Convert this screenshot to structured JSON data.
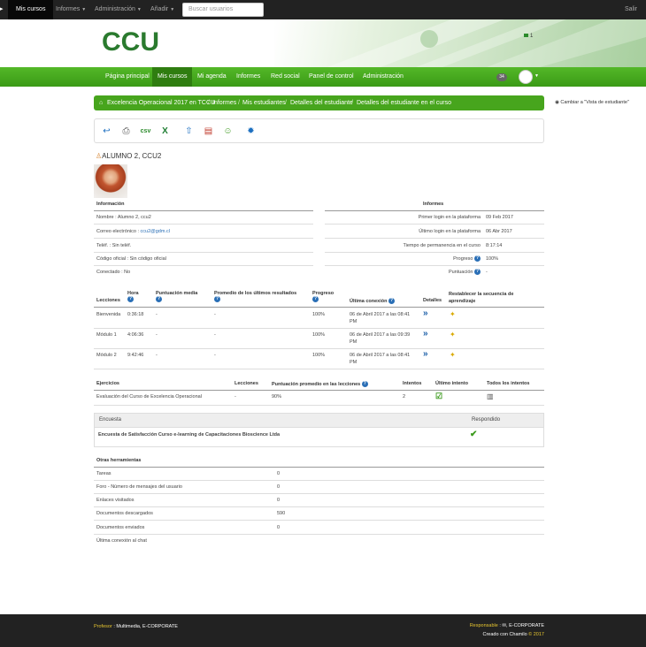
{
  "topbar": {
    "items": [
      "Mis cursos",
      "Informes",
      "Administración",
      "Añadir"
    ],
    "search_placeholder": "Buscar usuarios",
    "logout": "Salir"
  },
  "header": {
    "logo": "CCU",
    "flag_count": "1"
  },
  "nav": {
    "items": [
      "Página principal",
      "Mis cursos",
      "Mi agenda",
      "Informes",
      "Red social",
      "Panel de control",
      "Administración"
    ],
    "badge": "34"
  },
  "breadcrumb": {
    "items": [
      "Excelencia Operacional 2017 en TCCU",
      "Informes",
      "Mis estudiantes",
      "Detalles del estudiante",
      "Detalles del estudiante en el curso"
    ],
    "switch_label": "Cambiar a \"Vista de estudiante\""
  },
  "student": {
    "name": "ALUMNO 2, CCU2"
  },
  "info": {
    "heading": "Información",
    "rows": [
      {
        "label": "Nombre : Alumno 2, ccu2"
      },
      {
        "label": "Correo electrónico : ",
        "link": "ccu2@gdm.cl"
      },
      {
        "label": "Teléf. : Sin teléf."
      },
      {
        "label": "Código oficial : Sin código oficial"
      },
      {
        "label": "Conectado : No"
      }
    ]
  },
  "reports": {
    "heading": "Informes",
    "rows": [
      {
        "label": "Primer login en la plataforma",
        "value": "09 Feb 2017"
      },
      {
        "label": "Último login en la plataforma",
        "value": "06 Abr 2017"
      },
      {
        "label": "Tiempo de permanencia en el curso",
        "value": "8:17:14"
      },
      {
        "label": "Progreso",
        "value": "100%"
      },
      {
        "label": "Puntuación",
        "value": "-"
      }
    ]
  },
  "lessons": {
    "headers": [
      "Lecciones",
      "Hora",
      "Puntuación media",
      "Promedio de los últimos resultados",
      "Progreso",
      "Última conexión",
      "Detalles",
      "Restablecer la secuencia de aprendizaje"
    ],
    "rows": [
      {
        "name": "Bienvenida",
        "time": "0:36:18",
        "score": "-",
        "avg": "-",
        "progress": "100%",
        "last": "06 de Abril 2017 a las 08:41",
        "last2": "PM"
      },
      {
        "name": "Módulo 1",
        "time": "4:06:36",
        "score": "-",
        "avg": "-",
        "progress": "100%",
        "last": "06 de Abril 2017 a las 09:39",
        "last2": "PM"
      },
      {
        "name": "Módulo 2",
        "time": "9:42:46",
        "score": "-",
        "avg": "-",
        "progress": "100%",
        "last": "06 de Abril 2017 a las 08:41",
        "last2": "PM"
      }
    ]
  },
  "exercises": {
    "headers": [
      "Ejercicios",
      "Lecciones",
      "Puntuación promedio en las lecciones",
      "Intentos",
      "Último intento",
      "Todos los intentos"
    ],
    "rows": [
      {
        "name": "Evaluación del Curso de Excelencia Operacional",
        "lessons": "-",
        "score": "90%",
        "attempts": "2"
      }
    ]
  },
  "survey": {
    "headers": [
      "Encuesta",
      "Respondido"
    ],
    "rows": [
      {
        "name": "Encuesta de Satisfacción Curso e-learning de Capacitaciones Bioscience Ltda"
      }
    ]
  },
  "tools": {
    "heading": "Otras herramientas",
    "rows": [
      {
        "label": "Tareas",
        "value": "0"
      },
      {
        "label": "Foro - Número de mensajes del usuario",
        "value": "0"
      },
      {
        "label": "Enlaces visitados",
        "value": "0"
      },
      {
        "label": "Documentos descargados",
        "value": "590"
      },
      {
        "label": "Documentos enviados",
        "value": "0"
      },
      {
        "label": "Última conexión al chat",
        "value": ""
      }
    ]
  },
  "footer": {
    "left_label": "Profesor",
    "left_value": "Multimedia, E-CORPORATE",
    "right_label": "Responsable",
    "right_value": "E-CORPORATE",
    "created": "Creado con Chamilo",
    "year": "© 2017"
  },
  "colors": {
    "nav_green": "#47a51d",
    "topbar": "#222222",
    "link_blue": "#2a6fb6"
  }
}
